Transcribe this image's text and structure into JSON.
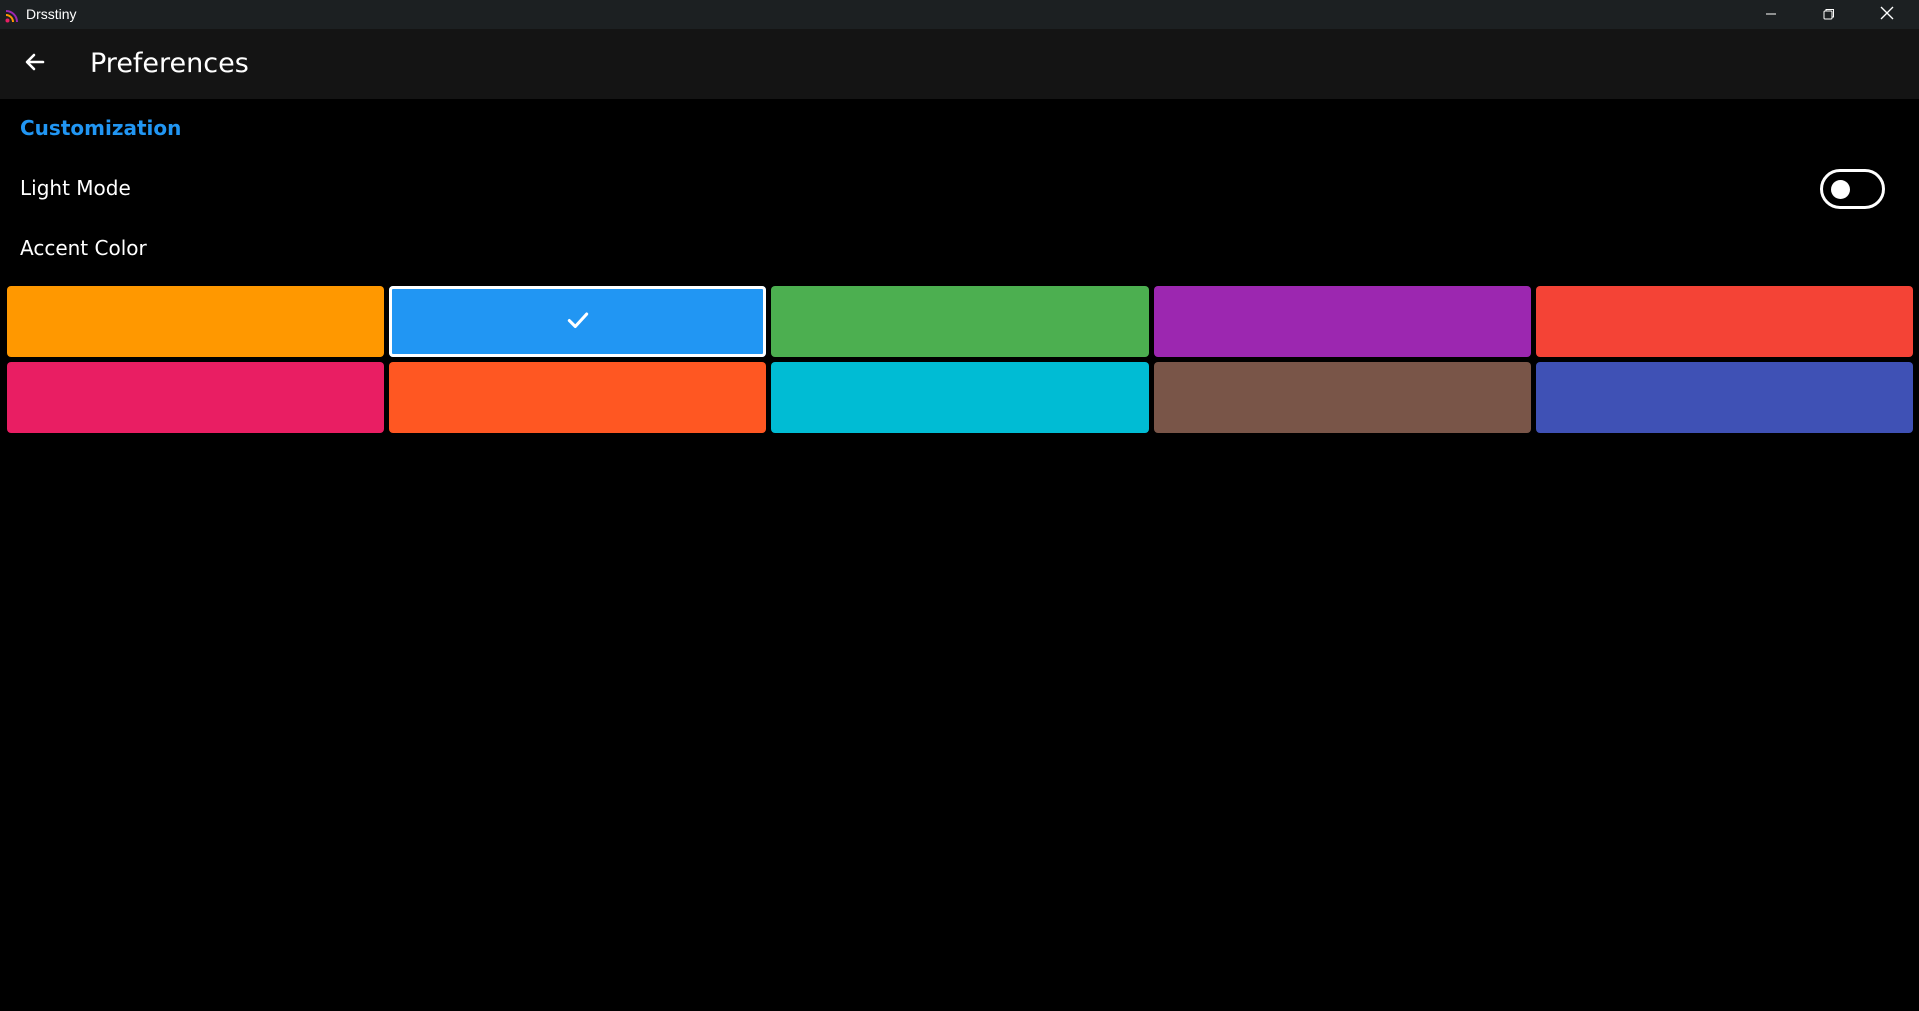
{
  "window": {
    "title": "Drsstiny",
    "controls": [
      "minimize-icon",
      "restore-icon",
      "close-icon"
    ]
  },
  "appbar": {
    "back_icon": "arrow-left-icon",
    "title": "Preferences"
  },
  "customization": {
    "header": "Customization",
    "accent": "#2196f3",
    "light_mode": {
      "label": "Light Mode",
      "enabled": false
    },
    "accent_color": {
      "label": "Accent Color",
      "selected_index": 1,
      "swatches": [
        "#ff9800",
        "#2196f3",
        "#4caf50",
        "#9c27b0",
        "#f44336",
        "#e91e63",
        "#ff5722",
        "#00bcd4",
        "#795548",
        "#3f51b5"
      ]
    }
  }
}
